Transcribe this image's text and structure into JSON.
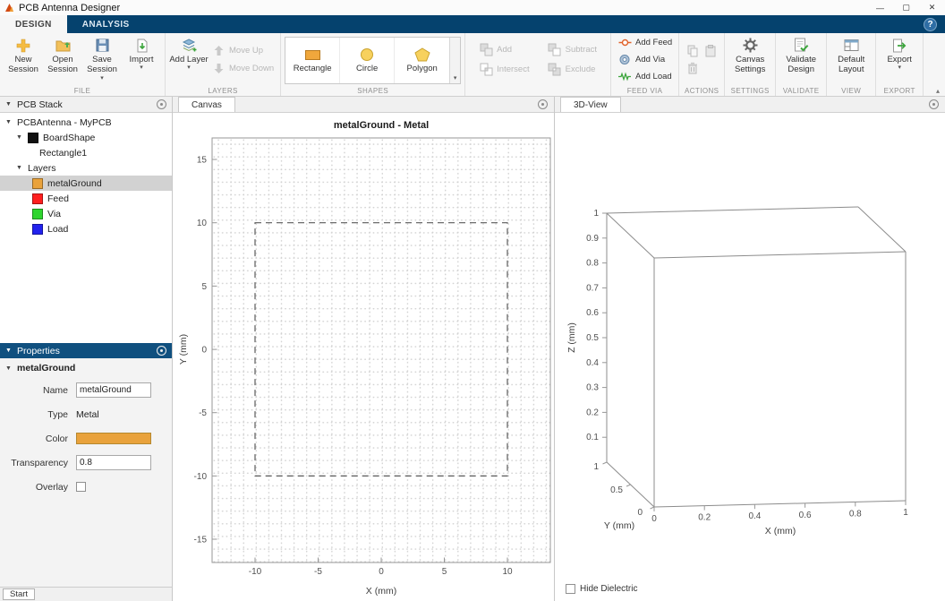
{
  "window": {
    "title": "PCB Antenna Designer",
    "minimize_glyph": "—",
    "maximize_glyph": "▢",
    "close_glyph": "✕"
  },
  "help": {
    "label": "?"
  },
  "ribbon": {
    "tabs": [
      {
        "label": "DESIGN"
      },
      {
        "label": "ANALYSIS"
      }
    ],
    "file": {
      "label": "FILE",
      "new_session": "New Session",
      "open_session": "Open Session",
      "save_session": "Save Session",
      "import": "Import"
    },
    "layers": {
      "label": "LAYERS",
      "add_layer": "Add Layer",
      "move_up": "Move Up",
      "move_down": "Move Down"
    },
    "shapes": {
      "label": "SHAPES",
      "rectangle": "Rectangle",
      "circle": "Circle",
      "polygon": "Polygon"
    },
    "boolean": {
      "label": "",
      "add": "Add",
      "subtract": "Subtract",
      "intersect": "Intersect",
      "exclude": "Exclude"
    },
    "feedvia": {
      "label": "FEED VIA",
      "add_feed": "Add Feed",
      "add_via": "Add Via",
      "add_load": "Add Load"
    },
    "actions": {
      "label": "ACTIONS"
    },
    "settings": {
      "label": "SETTINGS",
      "canvas_settings": "Canvas Settings"
    },
    "validate": {
      "label": "VALIDATE",
      "validate_design": "Validate Design"
    },
    "view": {
      "label": "VIEW",
      "default_layout": "Default Layout"
    },
    "export": {
      "label": "EXPORT",
      "export": "Export"
    }
  },
  "pcb_stack": {
    "title": "PCB Stack",
    "root_label": "PCBAntenna - MyPCB",
    "boardshape_label": "BoardShape",
    "boardshape_color": "#111111",
    "rectangle_label": "Rectangle1",
    "layers_label": "Layers",
    "layers": [
      {
        "name": "metalGround",
        "color": "#E9A23C",
        "selected": true
      },
      {
        "name": "Feed",
        "color": "#FF1F1F",
        "selected": false
      },
      {
        "name": "Via",
        "color": "#2FD52F",
        "selected": false
      },
      {
        "name": "Load",
        "color": "#2222EE",
        "selected": false
      }
    ]
  },
  "properties": {
    "title": "Properties",
    "section": "metalGround",
    "name_label": "Name",
    "name_value": "metalGround",
    "type_label": "Type",
    "type_value": "Metal",
    "color_label": "Color",
    "color_value": "#E9A23C",
    "transparency_label": "Transparency",
    "transparency_value": "0.8",
    "overlay_label": "Overlay",
    "overlay_checked": false
  },
  "canvas": {
    "tab": "Canvas",
    "plot": {
      "title": "metalGround - Metal",
      "xlabel": "X (mm)",
      "ylabel": "Y (mm)",
      "xticks": [
        "-10",
        "-5",
        "0",
        "5",
        "10"
      ],
      "yticks": [
        "15",
        "10",
        "5",
        "0",
        "-5",
        "-10",
        "-15"
      ],
      "xlim": [
        -13.4,
        13.4
      ],
      "ylim": [
        -16.8,
        16.8
      ],
      "shape": {
        "type": "rectangle",
        "x": [
          -10,
          10
        ],
        "y": [
          -10,
          10
        ],
        "line_style": "dashed"
      },
      "grid": "dotted-minor"
    }
  },
  "view3d": {
    "tab": "3D-View",
    "xlabel": "X (mm)",
    "ylabel": "Y (mm)",
    "zlabel": "Z (mm)",
    "xticks": [
      "0",
      "0.2",
      "0.4",
      "0.6",
      "0.8",
      "1"
    ],
    "yticks": [
      "0",
      "0.5",
      "1"
    ],
    "zticks": [
      "0.1",
      "0.2",
      "0.3",
      "0.4",
      "0.5",
      "0.6",
      "0.7",
      "0.8",
      "0.9",
      "1"
    ],
    "xlim": [
      0,
      1
    ],
    "ylim": [
      0,
      1
    ],
    "zlim": [
      0,
      1
    ],
    "hide_dielectric": "Hide Dielectric"
  },
  "statusbar": {
    "start": "Start"
  }
}
